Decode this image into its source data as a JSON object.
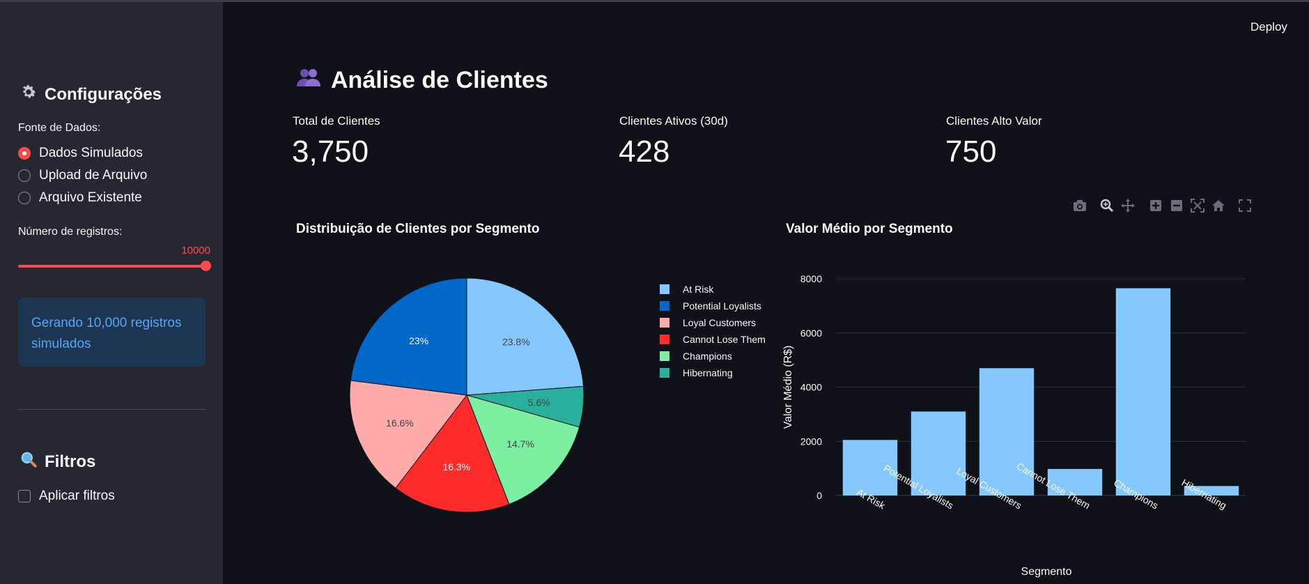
{
  "sidebar": {
    "config_title": "Configurações",
    "config_icon": "gear-icon",
    "source_label": "Fonte de Dados:",
    "source_options": [
      {
        "label": "Dados Simulados",
        "selected": true
      },
      {
        "label": "Upload de Arquivo",
        "selected": false
      },
      {
        "label": "Arquivo Existente",
        "selected": false
      }
    ],
    "records_label": "Número de registros:",
    "records_value": "10000",
    "info_text": "Gerando 10,000 registros simulados",
    "filters_title": "Filtros",
    "filters_icon": "magnifier-icon",
    "apply_filters_label": "Aplicar filtros"
  },
  "header": {
    "deploy_label": "Deploy",
    "menu_glyph": "⋮"
  },
  "main": {
    "title": "Análise de Clientes",
    "title_icon": "users-icon",
    "metrics": [
      {
        "label": "Total de Clientes",
        "value": "3,750"
      },
      {
        "label": "Clientes Ativos (30d)",
        "value": "428"
      },
      {
        "label": "Clientes Alto Valor",
        "value": "750"
      }
    ],
    "pie_title": "Distribuição de Clientes por Segmento",
    "bar_title": "Valor Médio por Segmento"
  },
  "colors": {
    "accent": "#ff4b4b",
    "sidebar_bg": "#262730",
    "app_bg": "#0e1117",
    "info_bg": "#1c3550",
    "info_text": "#57a6f5"
  },
  "chart_data": [
    {
      "type": "pie",
      "title": "Distribuição de Clientes por Segmento",
      "legend_position": "right",
      "slices": [
        {
          "label": "At Risk",
          "value": 23.8,
          "text": "23.8%",
          "color": "#85c8ff"
        },
        {
          "label": "Potential Loyalists",
          "value": 23.0,
          "text": "23%",
          "color": "#0068c9"
        },
        {
          "label": "Loyal Customers",
          "value": 16.6,
          "text": "16.6%",
          "color": "#ffabab"
        },
        {
          "label": "Cannot Lose Them",
          "value": 16.3,
          "text": "16.3%",
          "color": "#ff2b2b"
        },
        {
          "label": "Champions",
          "value": 14.7,
          "text": "14.7%",
          "color": "#7defa1"
        },
        {
          "label": "Hibernating",
          "value": 5.6,
          "text": "5.6%",
          "color": "#29b09d"
        }
      ],
      "draw_order": [
        "At Risk",
        "Hibernating",
        "Champions",
        "Cannot Lose Them",
        "Loyal Customers",
        "Potential Loyalists"
      ]
    },
    {
      "type": "bar",
      "title": "Valor Médio por Segmento",
      "categories": [
        "At Risk",
        "Potential Loyalists",
        "Loyal Customers",
        "Cannot Lose Them",
        "Champions",
        "Hibernating"
      ],
      "values": [
        2050,
        3100,
        4700,
        980,
        7650,
        350
      ],
      "xlabel": "Segmento",
      "ylabel": "Valor Médio (R$)",
      "ylim": [
        0,
        8000
      ],
      "yticks": [
        0,
        2000,
        4000,
        6000,
        8000
      ],
      "grid": true,
      "bar_color": "#85c8ff"
    }
  ]
}
